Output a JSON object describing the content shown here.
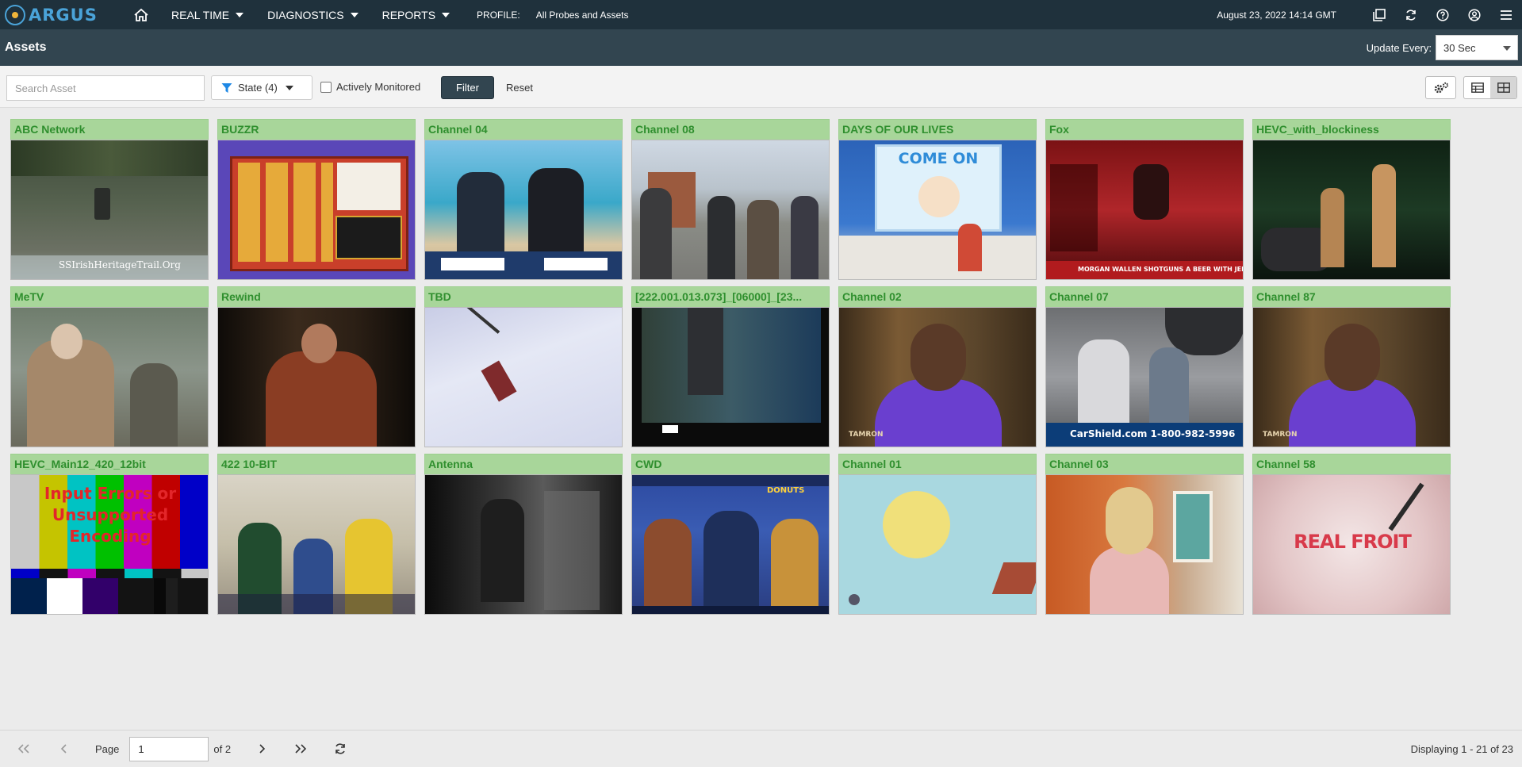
{
  "nav": {
    "logo": "ARGUS",
    "items": [
      {
        "label": "REAL TIME"
      },
      {
        "label": "DIAGNOSTICS"
      },
      {
        "label": "REPORTS"
      }
    ],
    "profile_label": "PROFILE:",
    "profile_value": "All Probes and Assets",
    "datetime": "August 23, 2022 14:14 GMT",
    "icons": [
      "windows-icon",
      "refresh-icon",
      "help-icon",
      "user-icon",
      "menu-icon"
    ]
  },
  "header": {
    "title": "Assets",
    "update_label": "Update Every:",
    "update_value": "30 Sec"
  },
  "toolbar": {
    "search_placeholder": "Search Asset",
    "state_label": "State (4)",
    "actively_monitored_label": "Actively Monitored",
    "actively_monitored_checked": false,
    "filter_label": "Filter",
    "reset_label": "Reset",
    "active_view": "tile-view"
  },
  "assets": [
    {
      "name": "ABC Network",
      "overlay": "SSIrishHeritageTrail.Org"
    },
    {
      "name": "BUZZR",
      "overlay": ""
    },
    {
      "name": "Channel 04",
      "overlay": ""
    },
    {
      "name": "Channel 08",
      "overlay": ""
    },
    {
      "name": "DAYS OF OUR LIVES",
      "overlay": "COME ON"
    },
    {
      "name": "Fox",
      "overlay": "MORGAN WALLEN SHOTGUNS A BEER WITH JEEZY!"
    },
    {
      "name": "HEVC_with_blockiness",
      "overlay": ""
    },
    {
      "name": "MeTV",
      "overlay": ""
    },
    {
      "name": "Rewind",
      "overlay": ""
    },
    {
      "name": "TBD",
      "overlay": ""
    },
    {
      "name": "[222.001.013.073]_[06000]_[23...",
      "overlay": ""
    },
    {
      "name": "Channel 02",
      "overlay": "TAMRON"
    },
    {
      "name": "Channel 07",
      "overlay": "CarShield.com 1-800-982-5996"
    },
    {
      "name": "Channel 87",
      "overlay": "TAMRON"
    },
    {
      "name": "HEVC_Main12_420_12bit",
      "overlay": "Input Errors or Unsupported Encoding"
    },
    {
      "name": "422 10-BIT",
      "overlay": ""
    },
    {
      "name": "Antenna",
      "overlay": ""
    },
    {
      "name": "CWD",
      "overlay": "DONUTS"
    },
    {
      "name": "Channel 01",
      "overlay": ""
    },
    {
      "name": "Channel 03",
      "overlay": ""
    },
    {
      "name": "Channel 58",
      "overlay": "REAL FROIT"
    }
  ],
  "pager": {
    "page_label": "Page",
    "page_value": "1",
    "of_label": "of 2",
    "display_text": "Displaying 1 - 21 of 23"
  },
  "colors": {
    "nav_bg": "#1f313c",
    "header_bg": "#324550",
    "tile_head_bg": "#a8d69a",
    "tile_head_text": "#2f8f2e",
    "accent": "#4aa3d8"
  }
}
